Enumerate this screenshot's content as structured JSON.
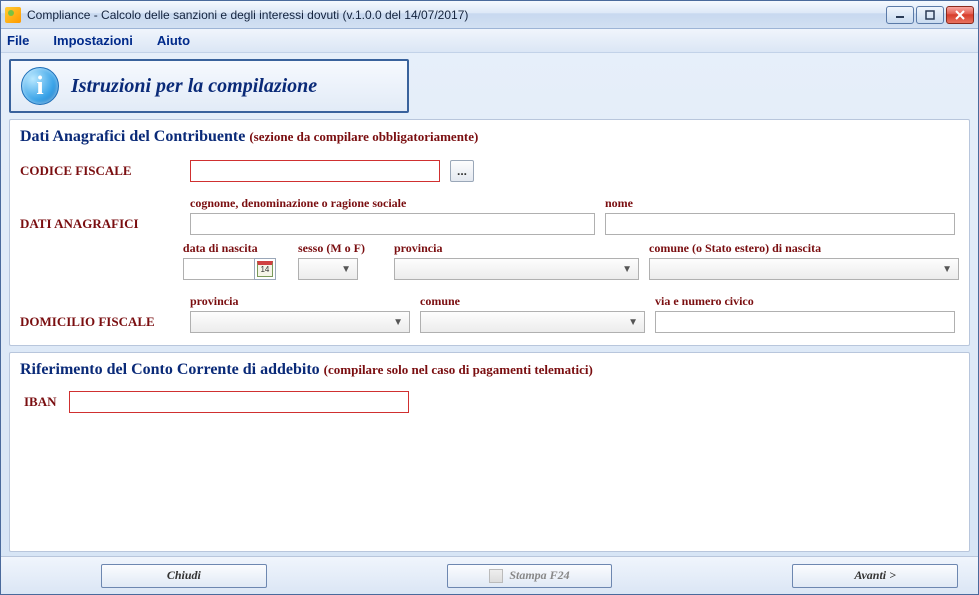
{
  "window": {
    "title": "Compliance - Calcolo delle sanzioni e degli interessi dovuti (v.1.0.0 del 14/07/2017)"
  },
  "menu": {
    "file": "File",
    "impostazioni": "Impostazioni",
    "aiuto": "Aiuto"
  },
  "instructions": {
    "label": "Istruzioni per la compilazione",
    "info_glyph": "i"
  },
  "anagrafica": {
    "heading": "Dati Anagrafici del Contribuente",
    "sub": "(sezione da compilare obbligatoriamente)",
    "codice_fiscale_label": "CODICE FISCALE",
    "codice_fiscale_value": "",
    "dots": "...",
    "dati_anagrafici_label": "DATI ANAGRAFICI",
    "cognome_label": "cognome, denominazione o ragione sociale",
    "cognome_value": "",
    "nome_label": "nome",
    "nome_value": "",
    "data_nascita_label": "data di nascita",
    "data_nascita_value": "",
    "cal_day": "14",
    "sesso_label": "sesso (M o F)",
    "sesso_value": "",
    "provincia_nascita_label": "provincia",
    "provincia_nascita_value": "",
    "comune_nascita_label": "comune (o Stato estero) di nascita",
    "comune_nascita_value": "",
    "domicilio_label": "DOMICILIO FISCALE",
    "dom_provincia_label": "provincia",
    "dom_provincia_value": "",
    "dom_comune_label": "comune",
    "dom_comune_value": "",
    "dom_via_label": "via e numero civico",
    "dom_via_value": ""
  },
  "conto": {
    "heading": "Riferimento del Conto Corrente di addebito",
    "sub": "(compilare solo nel caso di pagamenti telematici)",
    "iban_label": "IBAN",
    "iban_value": ""
  },
  "buttons": {
    "chiudi": "Chiudi",
    "stampa": "Stampa F24",
    "avanti": "Avanti >"
  }
}
